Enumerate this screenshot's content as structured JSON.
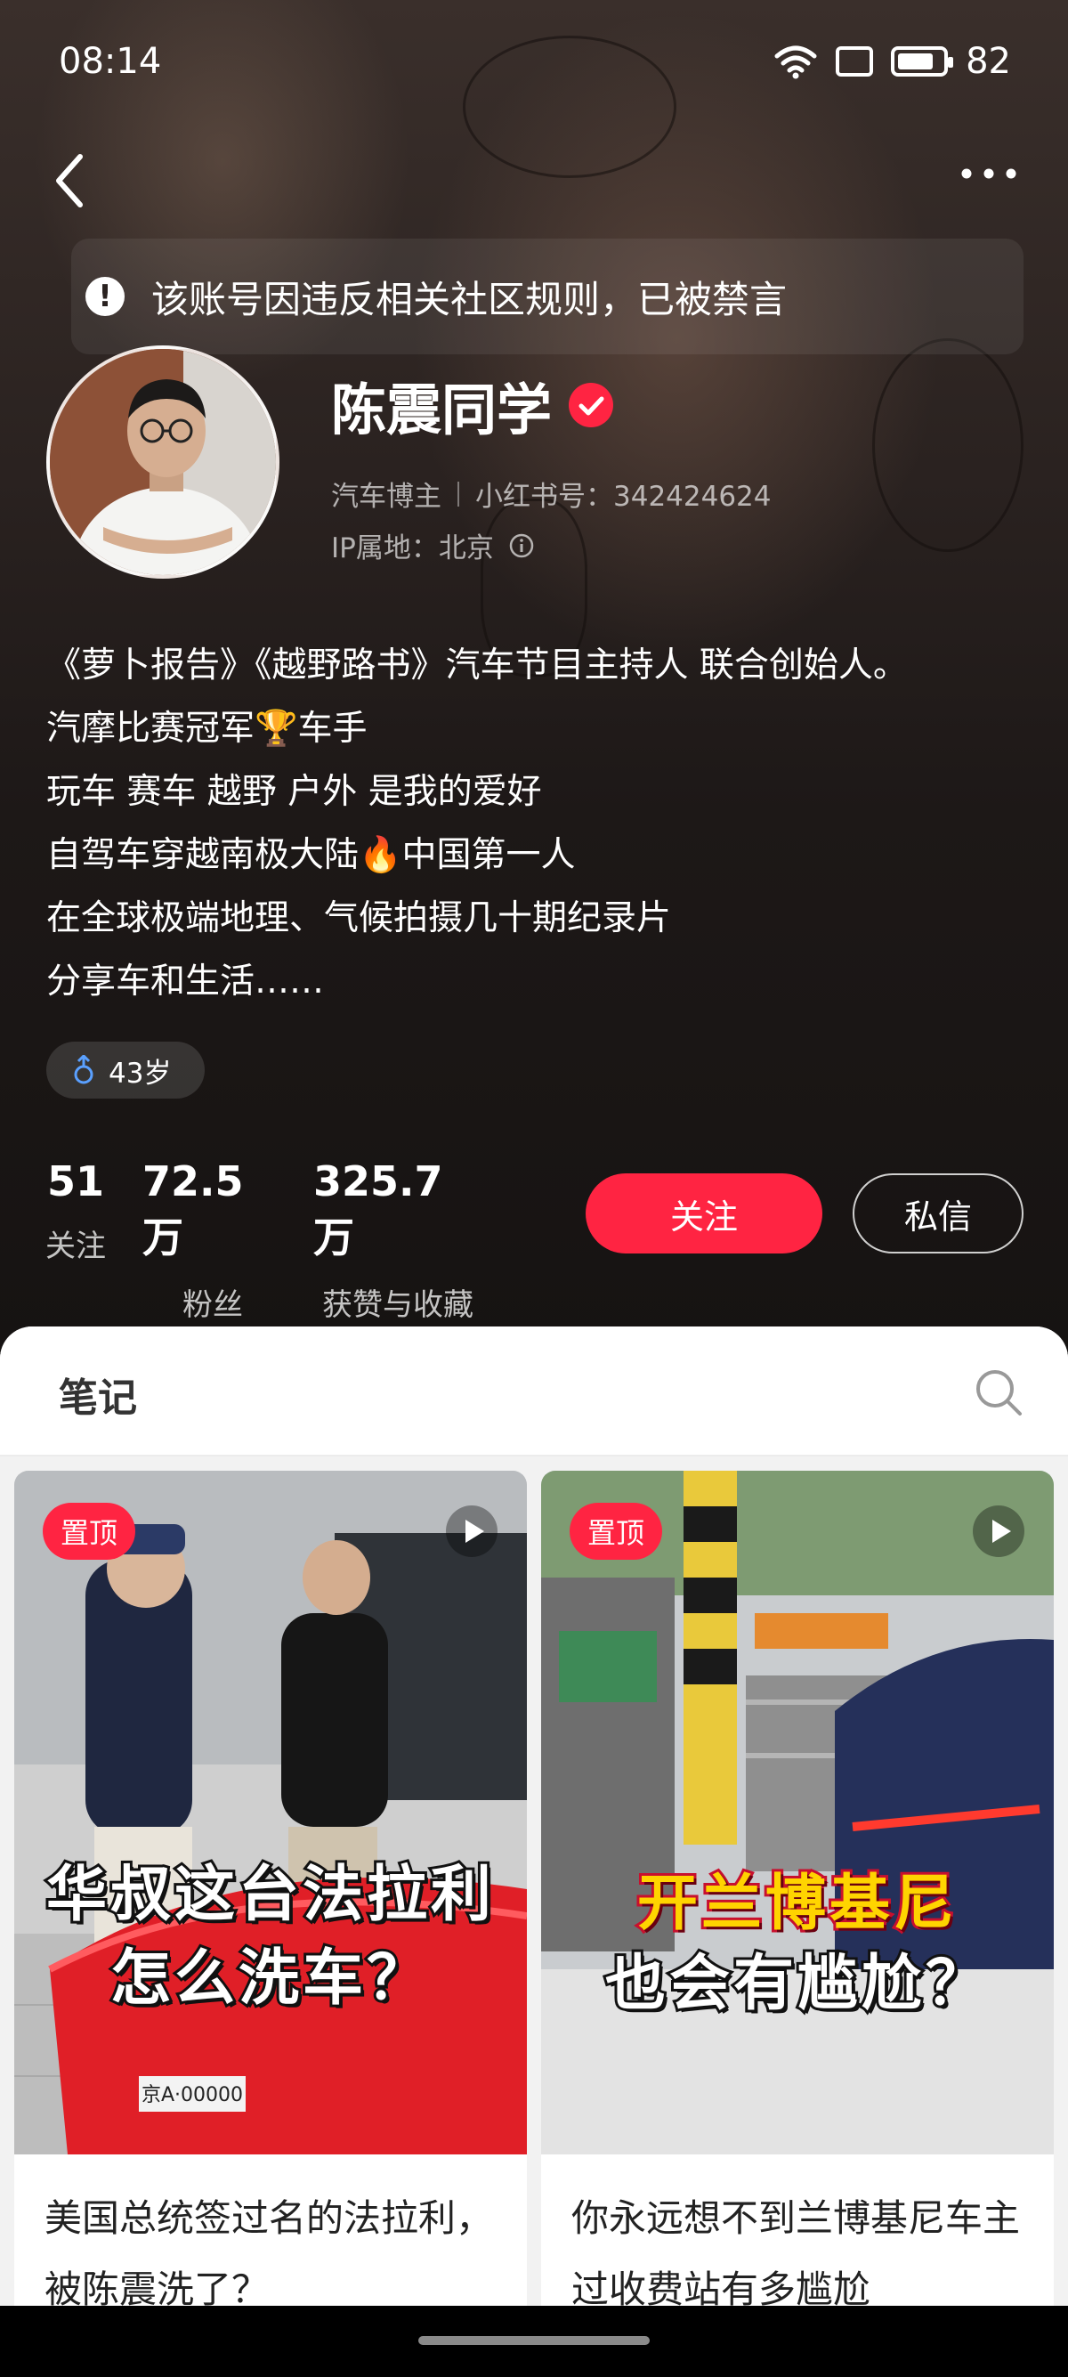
{
  "status_bar": {
    "time": "08:14",
    "battery": "82"
  },
  "notice": {
    "text": "该账号因违反相关社区规则，已被禁言"
  },
  "profile": {
    "name": "陈震同学",
    "category": "汽车博主",
    "account_id": "小红书号：342424624",
    "ip_location": "IP属地：北京",
    "bio_lines": [
      "《萝卜报告》《越野路书》汽车节目主持人 联合创始人。",
      "汽摩比赛冠军🏆车手",
      "玩车 赛车 越野 户外 是我的爱好",
      "自驾车穿越南极大陆🔥中国第一人",
      "在全球极端地理、气候拍摄几十期纪录片",
      "分享车和生活……"
    ],
    "age_tag": "43岁"
  },
  "stats": [
    {
      "value": "51",
      "label": "关注"
    },
    {
      "value": "72.5万",
      "label": "粉丝"
    },
    {
      "value": "325.7万",
      "label": "获赞与收藏"
    }
  ],
  "actions": {
    "follow": "关注",
    "message": "私信"
  },
  "tabs": {
    "notes": "笔记"
  },
  "notes": [
    {
      "pin_label": "置顶",
      "overlay_line1": "华叔这台法拉利",
      "overlay_line2": "怎么洗车？",
      "title": "美国总统签过名的法拉利，被陈震洗了？",
      "plate": "京A·00000"
    },
    {
      "pin_label": "置顶",
      "overlay_line1": "开兰博基尼",
      "overlay_line2": "也会有尴尬？",
      "title": "你永远想不到兰博基尼车主过收费站有多尴尬"
    }
  ],
  "colors": {
    "accent": "#ff2442"
  }
}
